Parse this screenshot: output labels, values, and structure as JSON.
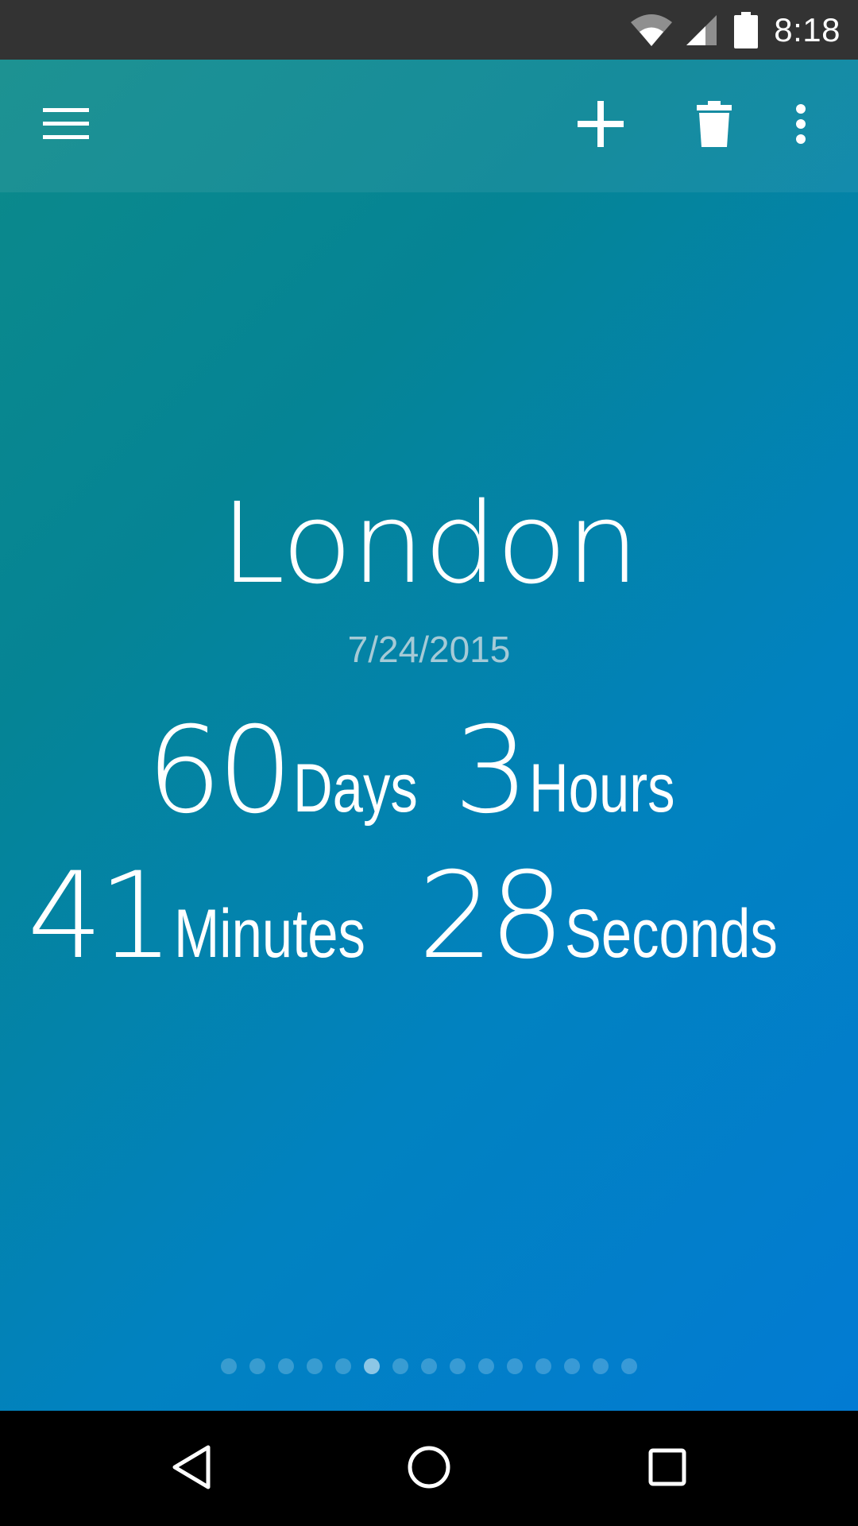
{
  "status_bar": {
    "time": "8:18",
    "icons": [
      "wifi-icon",
      "cell-signal-icon",
      "battery-icon"
    ]
  },
  "toolbar": {
    "icons": [
      "menu-icon",
      "add-icon",
      "delete-icon",
      "more-vert-icon"
    ]
  },
  "countdown": {
    "city": "London",
    "date": "7/24/2015",
    "days_value": "60",
    "days_label": "Days",
    "hours_value": "3",
    "hours_label": "Hours",
    "minutes_value": "41",
    "minutes_label": "Minutes",
    "seconds_value": "28",
    "seconds_label": "Seconds"
  },
  "pager": {
    "total": 15,
    "active_index": 5
  },
  "nav_bar": {
    "icons": [
      "back-icon",
      "home-icon",
      "recents-icon"
    ]
  },
  "colors": {
    "gradient_start": "#0c8a8a",
    "gradient_end": "#027bd3",
    "status_bar": "#333333"
  }
}
